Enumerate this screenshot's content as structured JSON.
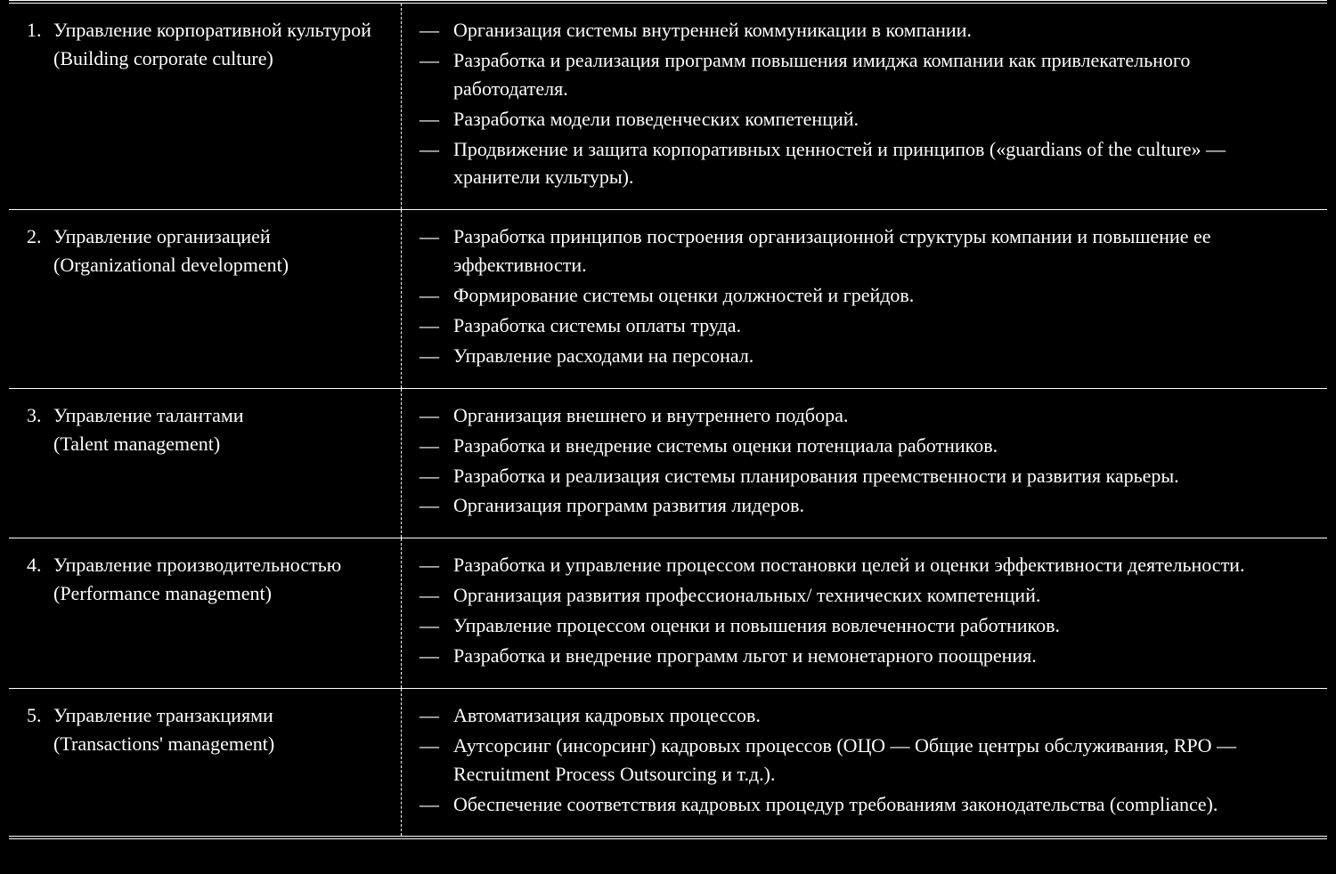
{
  "rows": [
    {
      "num": "1.",
      "title_ru": "Управление корпоративной культурой",
      "title_en": "(Building corporate culture)",
      "items": [
        "Организация системы внутренней коммуникации в компании.",
        "Разработка и реализация программ повышения имиджа компании как привлекательного работодателя.",
        "Разработка модели поведенческих компетенций.",
        "Продвижение и защита корпоративных ценностей и принципов («guardians of the culture» — хранители культуры)."
      ]
    },
    {
      "num": "2.",
      "title_ru": "Управление организацией",
      "title_en": "(Organizational development)",
      "items": [
        "Разработка принципов построения организационной структуры компании и повышение ее эффективности.",
        "Формирование системы оценки должностей и грейдов.",
        "Разработка системы оплаты труда.",
        "Управление расходами на персонал."
      ]
    },
    {
      "num": "3.",
      "title_ru": "Управление талантами",
      "title_en": "(Talent management)",
      "items": [
        "Организация внешнего и внутреннего подбора.",
        "Разработка и внедрение системы оценки потенциала работников.",
        "Разработка и реализация системы планирования преемственности и развития карьеры.",
        "Организация программ развития лидеров."
      ]
    },
    {
      "num": "4.",
      "title_ru": "Управление производительностью",
      "title_en": "(Performance management)",
      "items": [
        "Разработка и управление процессом постановки целей и оценки эффективности деятельности.",
        "Организация развития профессиональных/ технических компетенций.",
        "Управление процессом оценки и повышения вовлеченности работников.",
        "Разработка и внедрение программ льгот и немонетарного поощрения."
      ]
    },
    {
      "num": "5.",
      "title_ru": "Управление транзакциями",
      "title_en": "(Transactions' management)",
      "items": [
        "Автоматизация кадровых процессов.",
        "Аутсорсинг (инсорсинг) кадровых процессов (ОЦО — Общие центры обслуживания, RPO — Recruitment Process Outsourcing и т.д.).",
        "Обеспечение соответствия кадровых процедур требованиям законодательства (compliance)."
      ]
    }
  ]
}
